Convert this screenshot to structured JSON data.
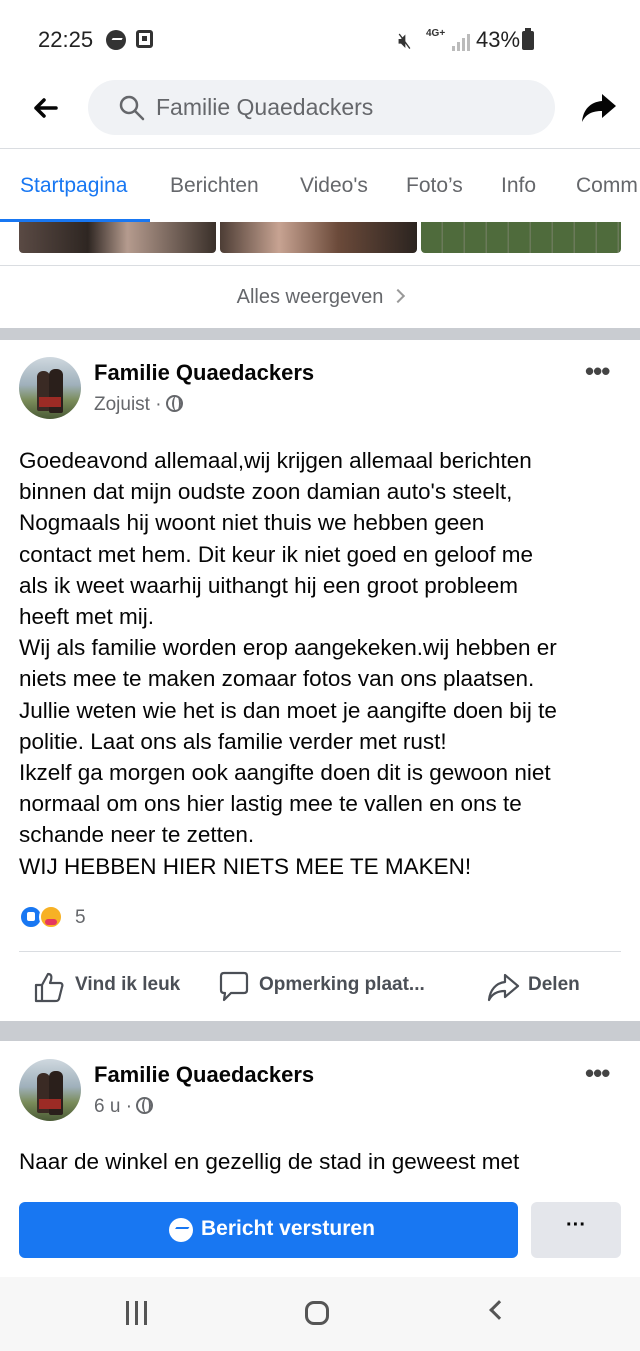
{
  "status_bar": {
    "time": "22:25",
    "network": "4G+",
    "battery": "43%"
  },
  "search": {
    "query": "Familie Quaedackers"
  },
  "tabs": [
    {
      "label": "Startpagina",
      "active": true
    },
    {
      "label": "Berichten",
      "active": false
    },
    {
      "label": "Video's",
      "active": false
    },
    {
      "label": "Foto’s",
      "active": false
    },
    {
      "label": "Info",
      "active": false
    },
    {
      "label": "Comm",
      "active": false
    }
  ],
  "photos": {
    "see_all_label": "Alles weergeven"
  },
  "posts": [
    {
      "author": "Familie Quaedackers",
      "time": "Zojuist",
      "separator": "·",
      "text": "Goedeavond  allemaal,wij krijgen allemaal berichten\nbinnen dat mijn oudste zoon damian auto's steelt,\nNogmaals hij woont niet thuis we hebben geen\ncontact met hem. Dit keur ik niet goed en geloof me\nals ik weet waarhij uithangt hij een groot probleem\nheeft met mij.\nWij als familie worden erop aangekeken.wij hebben er\nniets mee te maken zomaar fotos van ons plaatsen.\nJullie weten wie het is  dan moet je aangifte doen bij te\npolitie. Laat ons als  familie verder met rust!\nIkzelf ga morgen ook aangifte doen  dit is gewoon niet\nnormaal om ons hier lastig mee te vallen en ons te\nschande neer te zetten.\nWIJ HEBBEN HIER NIETS MEE TE MAKEN!",
      "reaction_count": "5",
      "actions": {
        "like": "Vind ik leuk",
        "comment": "Opmerking plaat...",
        "share": "Delen"
      }
    },
    {
      "author": "Familie Quaedackers",
      "time": "6 u",
      "separator": "·",
      "text": "Naar de winkel en gezellig de stad in geweest met"
    }
  ],
  "bottom_bar": {
    "send_message_label": "Bericht versturen",
    "more_label": "···"
  },
  "more_menu_label": "•••",
  "colors": {
    "accent": "#1877f2",
    "secondary_text": "#65676b",
    "separator": "#c9ccd1"
  }
}
